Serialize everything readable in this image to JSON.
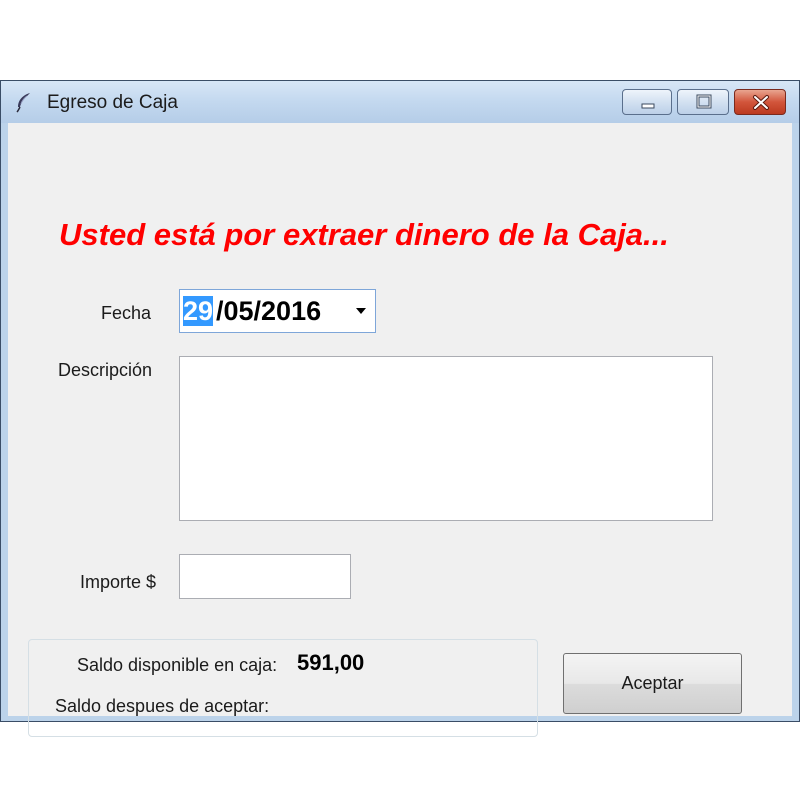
{
  "window": {
    "title": "Egreso de Caja"
  },
  "form": {
    "heading": "Usted está por extraer dinero de la Caja...",
    "fecha_label": "Fecha",
    "fecha_day": "29",
    "fecha_rest": "/05/2016",
    "descripcion_label": "Descripción",
    "descripcion_value": "",
    "importe_label": "Importe $",
    "importe_value": ""
  },
  "summary": {
    "saldo_disponible_label": "Saldo disponible en caja:",
    "saldo_disponible_value": "591,00",
    "saldo_despues_label": "Saldo despues de aceptar:",
    "saldo_despues_value": ""
  },
  "buttons": {
    "aceptar_label": "Aceptar"
  },
  "colors": {
    "heading": "#ff0000",
    "selection": "#3399ff",
    "close_button": "#c94a30"
  },
  "icons": {
    "app": "feather-icon",
    "minimize": "minimize-icon",
    "maximize": "maximize-icon",
    "close": "close-icon",
    "dropdown": "chevron-down-icon"
  }
}
